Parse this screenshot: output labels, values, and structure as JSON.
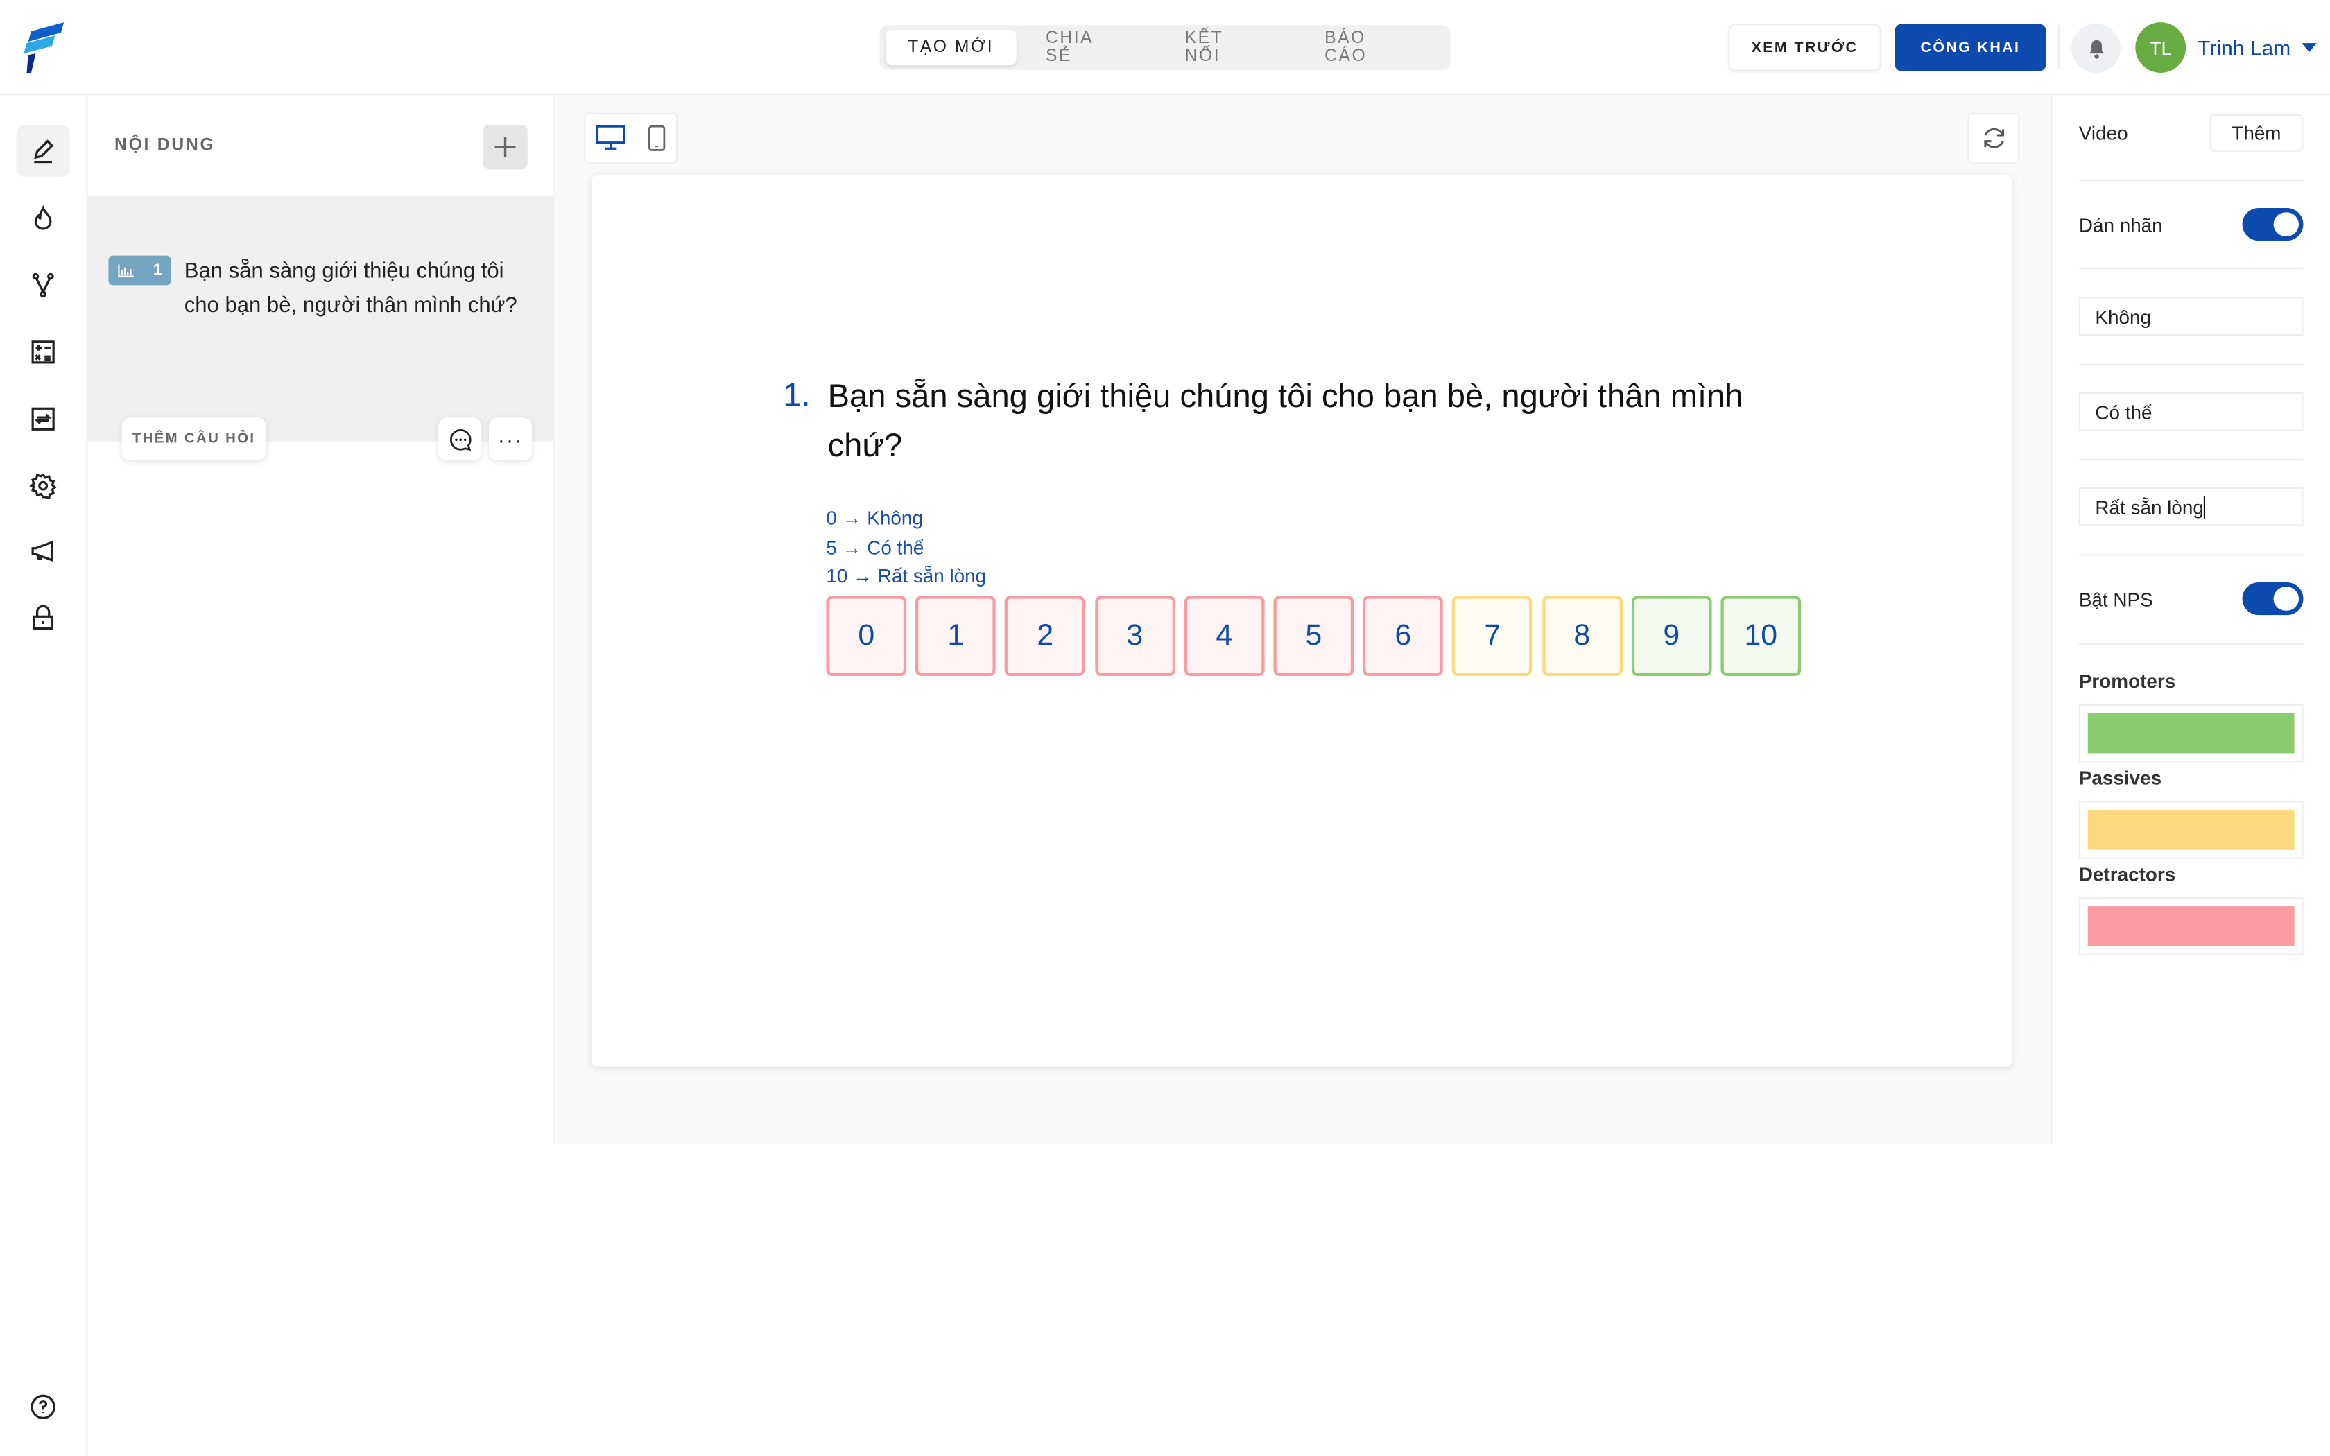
{
  "header": {
    "tabs": [
      {
        "label": "TẠO MỚI",
        "active": true
      },
      {
        "label": "CHIA SẺ"
      },
      {
        "label": "KẾT NỐI"
      },
      {
        "label": "BÁO CÁO"
      }
    ],
    "preview_label": "XEM TRƯỚC",
    "publish_label": "CÔNG KHAI",
    "avatar_initials": "TL",
    "user_name": "Trinh Lam",
    "brand_color": "#0d4aad"
  },
  "rail": {
    "icons": [
      "pencil-icon",
      "flame-icon",
      "branch-icon",
      "calculator-icon",
      "repeat-icon",
      "gear-icon",
      "megaphone-icon",
      "lock-icon"
    ],
    "help": "help-icon"
  },
  "panel": {
    "title": "NỘI DUNG",
    "question": {
      "number": "1",
      "type_icon": "bar-chart-icon",
      "text": "Bạn sẵn sàng giới thiệu chúng tôi cho bạn bè, người thân mình chứ?"
    },
    "add_question": "THÊM CÂU HỎI"
  },
  "preview": {
    "number": "1.",
    "question": "Bạn sẵn sàng giới thiệu chúng tôi cho bạn bè, người thân mình chứ?",
    "legend": [
      "0 → Không",
      "5 → Có thể",
      "10 → Rất sẵn lòng"
    ],
    "scale": [
      {
        "v": "0",
        "g": "d"
      },
      {
        "v": "1",
        "g": "d"
      },
      {
        "v": "2",
        "g": "d"
      },
      {
        "v": "3",
        "g": "d"
      },
      {
        "v": "4",
        "g": "d"
      },
      {
        "v": "5",
        "g": "d"
      },
      {
        "v": "6",
        "g": "d"
      },
      {
        "v": "7",
        "g": "p"
      },
      {
        "v": "8",
        "g": "p"
      },
      {
        "v": "9",
        "g": "r"
      },
      {
        "v": "10",
        "g": "r"
      }
    ]
  },
  "settings": {
    "video_label": "Video",
    "add_label": "Thêm",
    "label_toggle": "Dán nhãn",
    "label_toggle_on": true,
    "labels": [
      "Không",
      "Có thể",
      "Rất sẵn lòng"
    ],
    "nps_toggle": "Bật NPS",
    "nps_on": true,
    "promoters": "Promoters",
    "passives": "Passives",
    "detractors": "Detractors",
    "colors": {
      "promoters": "#8ccc70",
      "passives": "#fdd97e",
      "detractors": "#f99ba0"
    }
  }
}
